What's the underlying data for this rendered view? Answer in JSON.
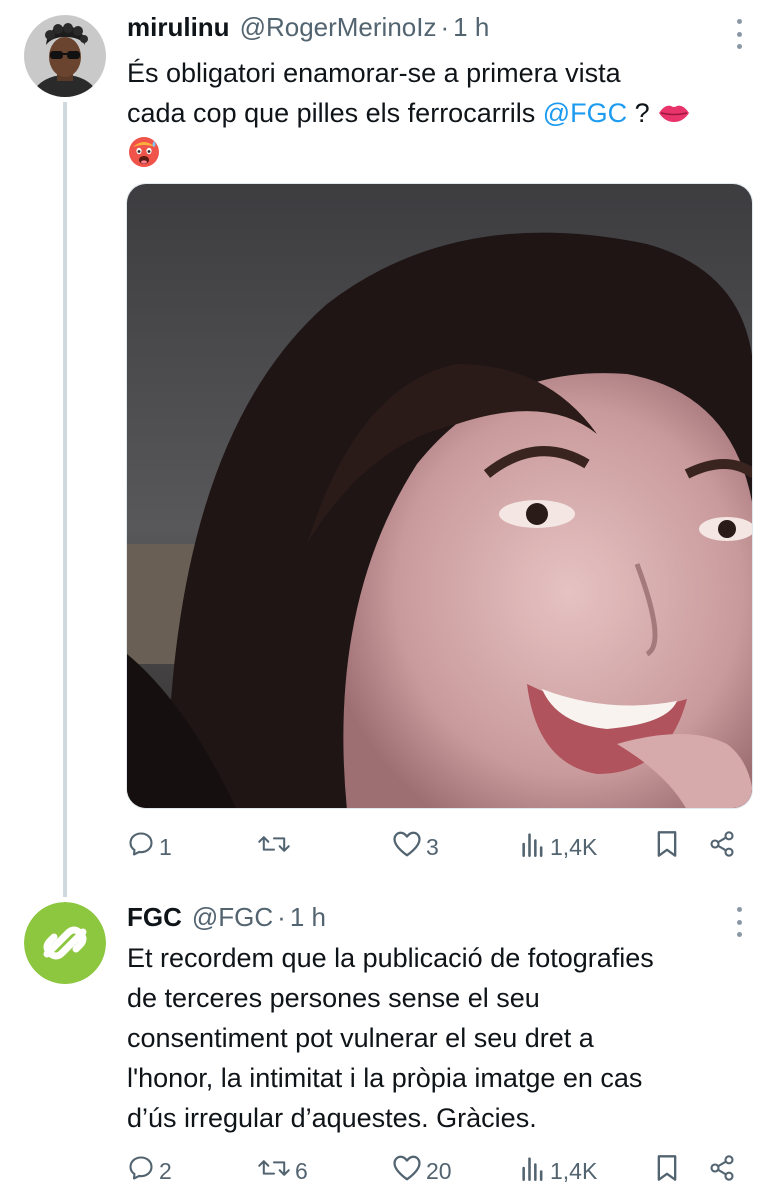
{
  "tweets": [
    {
      "name": "mirulinu",
      "handle": "@RogerMerinoIz",
      "separator": "·",
      "time": "1 h",
      "text_line1": "És obligatori enamorar-se a primera vista",
      "text_line2_prefix": "cada cop que pilles els ferrocarrils ",
      "mention": "@FGC",
      "text_line2_suffix": " ? ",
      "emojis": [
        "lips-emoji",
        "hot-face-emoji"
      ],
      "has_media": true,
      "actions": {
        "replies": "1",
        "retweets": "",
        "likes": "3",
        "views": "1,4K"
      }
    },
    {
      "name": "FGC",
      "handle": "@FGC",
      "separator": "·",
      "time": "1 h",
      "text_lines": [
        "Et recordem que la publicació de fotografies",
        "de terceres persones sense el seu",
        "consentiment pot vulnerar el seu dret a",
        "l'honor, la intimitat i la pròpia imatge en cas",
        "d’ús irregular d’aquestes. Gràcies."
      ],
      "actions": {
        "replies": "2",
        "retweets": "6",
        "likes": "20",
        "views": "1,4K"
      }
    }
  ],
  "colors": {
    "text": "#0f1419",
    "secondary": "#536471",
    "link": "#1d9bf0",
    "fgc_green": "#8dc63f",
    "thread_line": "#cfd9de"
  },
  "icons": [
    "reply-icon",
    "retweet-icon",
    "like-icon",
    "views-icon",
    "bookmark-icon",
    "share-icon",
    "more-icon"
  ]
}
